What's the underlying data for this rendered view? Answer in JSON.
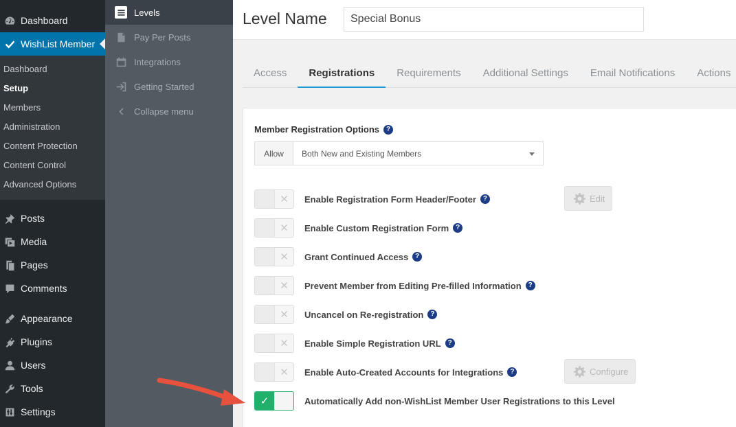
{
  "wp_menu": {
    "top": [
      {
        "label": "Dashboard",
        "icon": "dashboard-icon"
      },
      {
        "label": "WishList Member",
        "icon": "checkmark-icon",
        "current": true
      }
    ],
    "submenu": [
      "Dashboard",
      "Setup",
      "Members",
      "Administration",
      "Content Protection",
      "Content Control",
      "Advanced Options"
    ],
    "submenu_active": "Setup",
    "bottom": [
      {
        "label": "Posts",
        "icon": "pushpin-icon"
      },
      {
        "label": "Media",
        "icon": "media-icon"
      },
      {
        "label": "Pages",
        "icon": "pages-icon"
      },
      {
        "label": "Comments",
        "icon": "comments-icon"
      },
      {
        "label": "Appearance",
        "icon": "paintbrush-icon"
      },
      {
        "label": "Plugins",
        "icon": "plugin-icon"
      },
      {
        "label": "Users",
        "icon": "users-icon"
      },
      {
        "label": "Tools",
        "icon": "wrench-icon"
      },
      {
        "label": "Settings",
        "icon": "settings-icon"
      }
    ]
  },
  "wl_menu": {
    "items": [
      {
        "label": "Levels",
        "icon": "list-icon",
        "active": true
      },
      {
        "label": "Pay Per Posts",
        "icon": "document-icon"
      },
      {
        "label": "Integrations",
        "icon": "calendar-icon"
      },
      {
        "label": "Getting Started",
        "icon": "sign-in-icon"
      },
      {
        "label": "Collapse menu",
        "icon": "chevron-left-icon"
      }
    ]
  },
  "header": {
    "level_name_label": "Level Name",
    "level_name_value": "Special Bonus"
  },
  "tabs": [
    "Access",
    "Registrations",
    "Requirements",
    "Additional Settings",
    "Email Notifications",
    "Actions"
  ],
  "active_tab": "Registrations",
  "registration": {
    "options_label": "Member Registration Options",
    "allow_addon": "Allow",
    "allow_value": "Both New and Existing Members",
    "options": [
      {
        "label": "Enable Registration Form Header/Footer",
        "enabled": false,
        "button": "Edit"
      },
      {
        "label": "Enable Custom Registration Form",
        "enabled": false
      },
      {
        "label": "Grant Continued Access",
        "enabled": false
      },
      {
        "label": "Prevent Member from Editing Pre-filled Information",
        "enabled": false
      },
      {
        "label": "Uncancel on Re-registration",
        "enabled": false
      },
      {
        "label": "Enable Simple Registration URL",
        "enabled": false
      },
      {
        "label": "Enable Auto-Created Accounts for Integrations",
        "enabled": false,
        "button": "Configure"
      },
      {
        "label": "Automatically Add non-WishList Member User Registrations to this Level",
        "enabled": true
      }
    ]
  },
  "colors": {
    "wp_sidebar": "#23282d",
    "wp_current": "#0073aa",
    "wl_sidebar": "#525a62",
    "tab_accent": "#1e9bd8",
    "toggle_on": "#21b06c",
    "help_icon": "#1c3c87",
    "arrow": "#e8513d"
  }
}
